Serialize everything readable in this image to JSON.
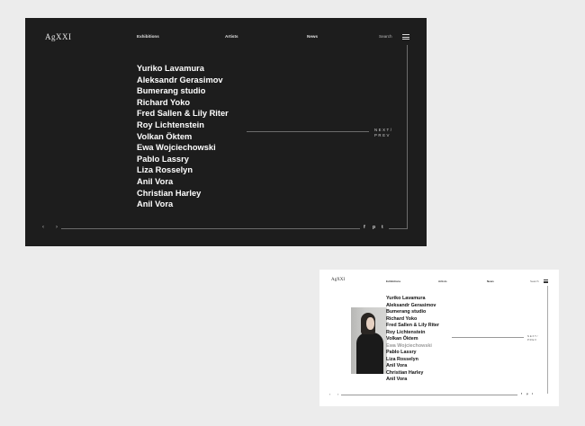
{
  "brand": {
    "logo": "AgXXI"
  },
  "nav": {
    "exhibitions": "Exhibitions",
    "artists": "Artists",
    "news": "News",
    "search": "Search"
  },
  "artists": [
    "Yuriko Lavamura",
    "Aleksandr Gerasimov",
    "Bumerang studio",
    "Richard Yoko",
    "Fred Sallen & Lily Riter",
    "Roy Lichtenstein",
    "Volkan Öktem",
    "Ewa Wojciechowski",
    "Pablo Lassry",
    "Liza Rosselyn",
    "Anil Vora",
    "Christian Harley",
    "Anil Vora"
  ],
  "pager": {
    "next": "NEXT/",
    "prev": "PREV",
    "back_arrow": "‹",
    "forward_arrow": "›"
  },
  "social": {
    "facebook": "f",
    "pinterest": "p",
    "twitter": "t"
  },
  "colors": {
    "dark_bg": "#1d1d1d",
    "light_bg": "#ffffff",
    "page_bg": "#ececec"
  },
  "light_hovered_index": 7
}
